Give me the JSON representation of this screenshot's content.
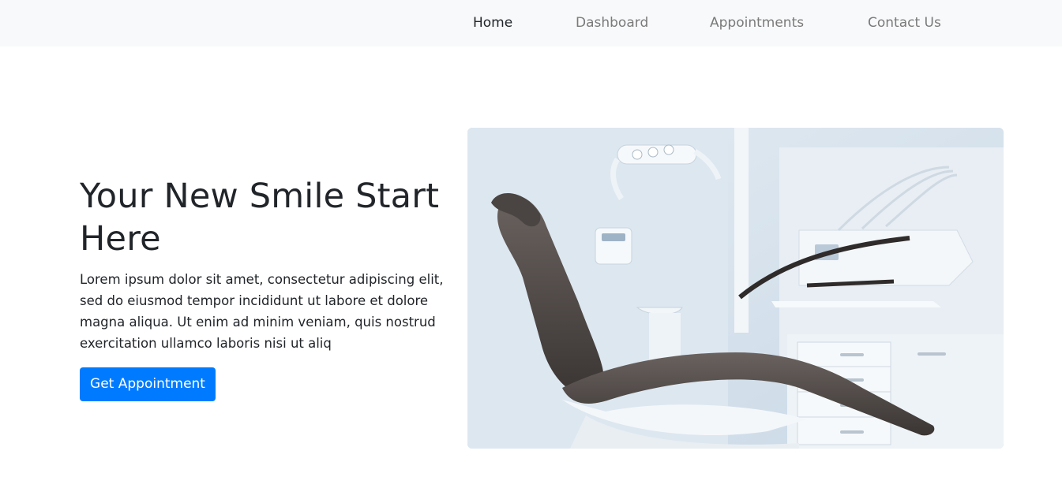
{
  "nav": {
    "items": [
      {
        "label": "Home",
        "active": true
      },
      {
        "label": "Dashboard",
        "active": false
      },
      {
        "label": "Appointments",
        "active": false
      },
      {
        "label": "Contact Us",
        "active": false
      }
    ]
  },
  "hero": {
    "title": "Your New Smile Start Here",
    "text": "Lorem ipsum dolor sit amet, consectetur adipiscing elit, sed do eiusmod tempor incididunt ut labore et dolore magna aliqua. Ut enim ad minim veniam, quis nostrud exercitation ullamco laboris nisi ut aliq",
    "cta_label": "Get Appointment",
    "image_subject": "dental-chair-photo"
  },
  "colors": {
    "nav_bg": "#f8f9fa",
    "primary": "#007bff",
    "text": "#212529",
    "nav_inactive": "#7a7a7a"
  }
}
